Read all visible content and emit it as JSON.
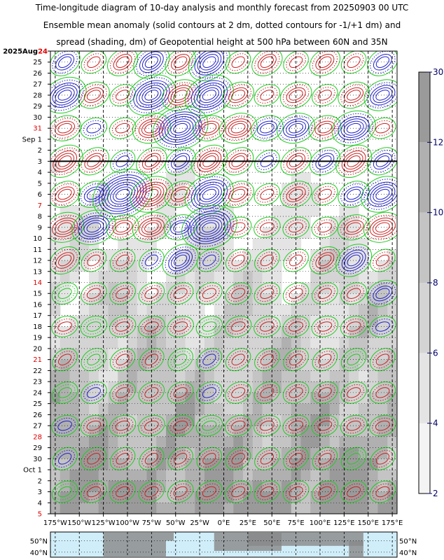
{
  "title": {
    "line1": "Time-longitude diagram of 10-day analysis and monthly forecast from 20250903 00 UTC",
    "line2": "Ensemble mean anomaly (solid contours at 2 dm, dotted contours for -1/+1 dm) and",
    "line3": "spread (shading, dm) of Geopotential height at 500 hPa between 60N and 35N"
  },
  "colors": {
    "positive_contour": "#cc2222",
    "negative_contour": "#2222cc",
    "zero_contour": "#22cc22",
    "weekend_label": "#dd0000",
    "weekday_label": "#000000",
    "colorbar_label": "#000066",
    "map_ocean": "#d0eefa",
    "map_land": "#888888"
  },
  "chart_data": {
    "type": "heatmap",
    "x_axis": {
      "unit": "longitude",
      "range": [
        -180,
        180
      ],
      "ticks": [
        {
          "value": -175,
          "label": "175°W"
        },
        {
          "value": -150,
          "label": "150°W"
        },
        {
          "value": -125,
          "label": "125°W"
        },
        {
          "value": -100,
          "label": "100°W"
        },
        {
          "value": -75,
          "label": "75°W"
        },
        {
          "value": -50,
          "label": "50°W"
        },
        {
          "value": -25,
          "label": "25°W"
        },
        {
          "value": 0,
          "label": "0°E"
        },
        {
          "value": 25,
          "label": "25°E"
        },
        {
          "value": 50,
          "label": "50°E"
        },
        {
          "value": 75,
          "label": "75°E"
        },
        {
          "value": 100,
          "label": "100°E"
        },
        {
          "value": 125,
          "label": "125°E"
        },
        {
          "value": 150,
          "label": "150°E"
        },
        {
          "value": 175,
          "label": "175°E"
        }
      ]
    },
    "y_axis": {
      "unit": "date",
      "first_label": "2025Aug24",
      "analysis_end_date": "Sep 3",
      "dates": [
        {
          "label": "24",
          "red": true
        },
        {
          "label": "25",
          "red": false
        },
        {
          "label": "26",
          "red": false
        },
        {
          "label": "27",
          "red": false
        },
        {
          "label": "28",
          "red": false
        },
        {
          "label": "29",
          "red": false
        },
        {
          "label": "30",
          "red": false
        },
        {
          "label": "31",
          "red": true
        },
        {
          "label": "Sep 1",
          "red": false
        },
        {
          "label": "2",
          "red": false
        },
        {
          "label": "3",
          "red": false
        },
        {
          "label": "4",
          "red": false
        },
        {
          "label": "5",
          "red": false
        },
        {
          "label": "6",
          "red": false
        },
        {
          "label": "7",
          "red": true
        },
        {
          "label": "8",
          "red": false
        },
        {
          "label": "9",
          "red": false
        },
        {
          "label": "10",
          "red": false
        },
        {
          "label": "11",
          "red": false
        },
        {
          "label": "12",
          "red": false
        },
        {
          "label": "13",
          "red": false
        },
        {
          "label": "14",
          "red": true
        },
        {
          "label": "15",
          "red": false
        },
        {
          "label": "16",
          "red": false
        },
        {
          "label": "17",
          "red": false
        },
        {
          "label": "18",
          "red": false
        },
        {
          "label": "19",
          "red": false
        },
        {
          "label": "20",
          "red": false
        },
        {
          "label": "21",
          "red": true
        },
        {
          "label": "22",
          "red": false
        },
        {
          "label": "23",
          "red": false
        },
        {
          "label": "24",
          "red": false
        },
        {
          "label": "25",
          "red": false
        },
        {
          "label": "26",
          "red": false
        },
        {
          "label": "27",
          "red": false
        },
        {
          "label": "28",
          "red": true
        },
        {
          "label": "29",
          "red": false
        },
        {
          "label": "30",
          "red": false
        },
        {
          "label": "Oct 1",
          "red": false
        },
        {
          "label": "2",
          "red": false
        },
        {
          "label": "3",
          "red": false
        },
        {
          "label": "4",
          "red": false
        },
        {
          "label": "5",
          "red": true
        }
      ]
    },
    "colorbar": {
      "unit": "dm",
      "range": [
        2,
        30
      ],
      "levels": [
        {
          "value": 2,
          "label": "2",
          "color": "#f4f4f4"
        },
        {
          "value": 4,
          "label": "4",
          "color": "#e4e4e4"
        },
        {
          "value": 6,
          "label": "6",
          "color": "#d4d4d4"
        },
        {
          "value": 8,
          "label": "8",
          "color": "#c4c4c4"
        },
        {
          "value": 10,
          "label": "10",
          "color": "#b0b0b0"
        },
        {
          "value": 12,
          "label": "12",
          "color": "#9a9a9a"
        },
        {
          "value": 30,
          "label": "30",
          "color": "#9a9a9a"
        }
      ]
    },
    "anomaly_sample": {
      "description_of_values": "approximate ensemble mean anomaly (dm) sampled every 30 degrees of longitude, every 3 days",
      "longitudes": [
        -165,
        -135,
        -105,
        -75,
        -45,
        -15,
        15,
        45,
        75,
        105,
        135,
        165
      ],
      "rows": [
        {
          "date": "Aug 25",
          "values": [
            -4,
            2,
            4,
            -6,
            4,
            -8,
            2,
            4,
            2,
            4,
            2,
            -4
          ]
        },
        {
          "date": "Aug 28",
          "values": [
            -8,
            4,
            2,
            -10,
            6,
            -10,
            4,
            2,
            4,
            2,
            4,
            -6
          ]
        },
        {
          "date": "Aug 31",
          "values": [
            4,
            -2,
            2,
            6,
            -12,
            4,
            6,
            -4,
            -6,
            4,
            -8,
            2
          ]
        },
        {
          "date": "Sep 3",
          "values": [
            6,
            4,
            -2,
            4,
            -4,
            6,
            4,
            -2,
            4,
            -4,
            6,
            -4
          ]
        },
        {
          "date": "Sep 6",
          "values": [
            4,
            -4,
            -14,
            8,
            4,
            -10,
            4,
            2,
            4,
            2,
            -4,
            -8
          ]
        },
        {
          "date": "Sep 9",
          "values": [
            6,
            -8,
            4,
            6,
            -4,
            -12,
            2,
            2,
            2,
            2,
            4,
            6
          ]
        },
        {
          "date": "Sep 12",
          "values": [
            4,
            2,
            2,
            -2,
            -6,
            -2,
            2,
            2,
            2,
            4,
            -6,
            2
          ]
        },
        {
          "date": "Sep 15",
          "values": [
            0,
            2,
            2,
            2,
            2,
            2,
            2,
            2,
            2,
            2,
            2,
            -4
          ]
        },
        {
          "date": "Sep 18",
          "values": [
            2,
            0,
            2,
            2,
            2,
            0,
            2,
            2,
            2,
            2,
            2,
            -2
          ]
        },
        {
          "date": "Sep 21",
          "values": [
            2,
            0,
            2,
            2,
            0,
            -2,
            2,
            2,
            2,
            2,
            0,
            2
          ]
        },
        {
          "date": "Sep 24",
          "values": [
            0,
            -2,
            2,
            2,
            2,
            -2,
            2,
            2,
            2,
            2,
            2,
            2
          ]
        },
        {
          "date": "Sep 27",
          "values": [
            -2,
            2,
            2,
            2,
            2,
            0,
            2,
            2,
            2,
            2,
            2,
            2
          ]
        },
        {
          "date": "Sep 30",
          "values": [
            -2,
            2,
            2,
            2,
            2,
            2,
            2,
            2,
            2,
            2,
            0,
            2
          ]
        },
        {
          "date": "Oct 3",
          "values": [
            0,
            2,
            2,
            2,
            2,
            2,
            2,
            2,
            2,
            2,
            2,
            2
          ]
        }
      ]
    },
    "spread_sample": {
      "description_of_values": "approximate ensemble spread (dm), same sampling grid",
      "rows": [
        {
          "date": "Sep 6",
          "values": [
            3,
            3,
            3,
            3,
            4,
            4,
            4,
            3,
            3,
            3,
            3,
            3
          ]
        },
        {
          "date": "Sep 12",
          "values": [
            5,
            5,
            5,
            6,
            7,
            6,
            6,
            5,
            5,
            5,
            5,
            5
          ]
        },
        {
          "date": "Sep 18",
          "values": [
            8,
            8,
            8,
            8,
            9,
            8,
            8,
            8,
            8,
            7,
            7,
            8
          ]
        },
        {
          "date": "Sep 24",
          "values": [
            9,
            10,
            10,
            9,
            10,
            9,
            9,
            9,
            9,
            9,
            9,
            9
          ]
        },
        {
          "date": "Sep 30",
          "values": [
            10,
            11,
            10,
            10,
            10,
            10,
            10,
            10,
            10,
            10,
            10,
            10
          ]
        },
        {
          "date": "Oct 5",
          "values": [
            10,
            11,
            11,
            10,
            10,
            10,
            10,
            10,
            10,
            10,
            10,
            10
          ]
        }
      ]
    },
    "map_strip": {
      "lat_labels_left": [
        "50°N",
        "40°N"
      ],
      "lat_labels_right": [
        "50°N",
        "40°N"
      ]
    }
  }
}
